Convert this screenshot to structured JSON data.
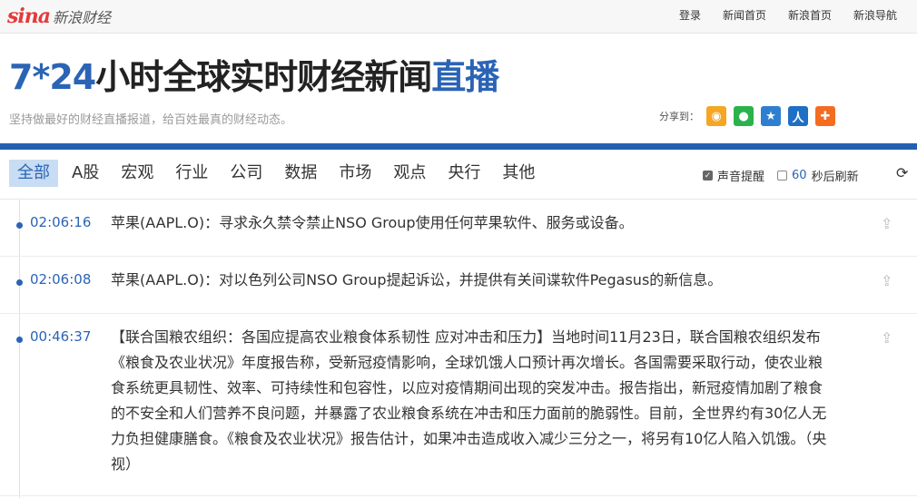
{
  "logo": {
    "brand": "sina",
    "sub": "新浪财经"
  },
  "top_nav": [
    {
      "label": "登录"
    },
    {
      "label": "新闻首页"
    },
    {
      "label": "新浪首页"
    },
    {
      "label": "新浪导航"
    }
  ],
  "headline": {
    "part1": "7*24",
    "part2": "小时全球实时财经新闻",
    "part3": "直播"
  },
  "tagline": "坚持做最好的财经直播报道，给百姓最真的财经动态。",
  "share": {
    "label": "分享到：",
    "icons": [
      {
        "name": "weibo-icon",
        "color": "#f5a623",
        "glyph": "◉"
      },
      {
        "name": "wechat-icon",
        "color": "#2bb24c",
        "glyph": "●"
      },
      {
        "name": "qzone-icon",
        "color": "#2e7fd1",
        "glyph": "★"
      },
      {
        "name": "renren-icon",
        "color": "#1f6fc5",
        "glyph": "人"
      },
      {
        "name": "more-icon",
        "color": "#f36c21",
        "glyph": "✚"
      }
    ]
  },
  "tabs": [
    {
      "label": "全部",
      "active": true
    },
    {
      "label": "A股"
    },
    {
      "label": "宏观"
    },
    {
      "label": "行业"
    },
    {
      "label": "公司"
    },
    {
      "label": "数据"
    },
    {
      "label": "市场"
    },
    {
      "label": "观点"
    },
    {
      "label": "央行"
    },
    {
      "label": "其他"
    }
  ],
  "controls": {
    "sound_label": "声音提醒",
    "sound_checked": true,
    "refresh_seconds": "60",
    "refresh_label": "秒后刷新",
    "refresh_checked": false
  },
  "news": [
    {
      "time": "02:06:16",
      "text": "苹果(AAPL.O)：寻求永久禁令禁止NSO Group使用任何苹果软件、服务或设备。"
    },
    {
      "time": "02:06:08",
      "text": "苹果(AAPL.O)：对以色列公司NSO Group提起诉讼，并提供有关间谍软件Pegasus的新信息。"
    },
    {
      "time": "00:46:37",
      "text": "【联合国粮农组织：各国应提高农业粮食体系韧性 应对冲击和压力】当地时间11月23日，联合国粮农组织发布《粮食及农业状况》年度报告称，受新冠疫情影响，全球饥饿人口预计再次增长。各国需要采取行动，使农业粮食系统更具韧性、效率、可持续性和包容性，以应对疫情期间出现的突发冲击。报告指出，新冠疫情加剧了粮食的不安全和人们营养不良问题，并暴露了农业粮食系统在冲击和压力面前的脆弱性。目前，全世界约有30亿人无力负担健康膳食。《粮食及农业状况》报告估计，如果冲击造成收入减少三分之一，将另有10亿人陷入饥饿。（央视）"
    }
  ]
}
